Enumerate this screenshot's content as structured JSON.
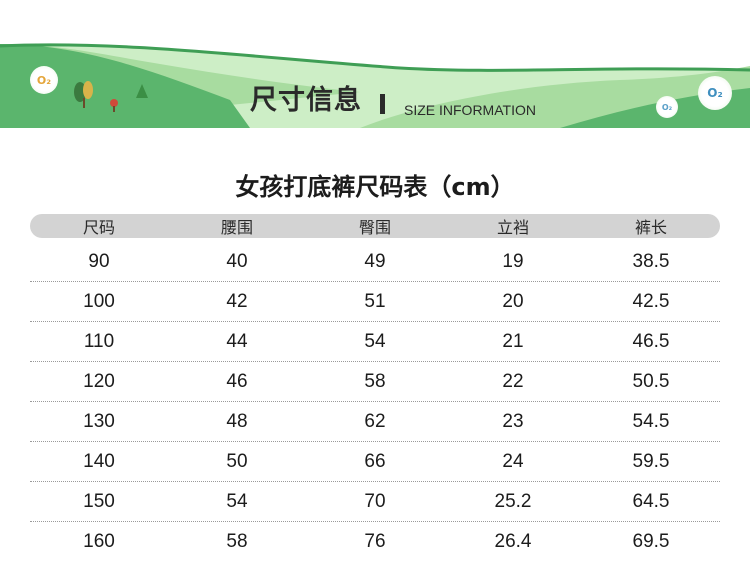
{
  "banner": {
    "title": "尺寸信息",
    "subtitle": "SIZE INFORMATION",
    "badge_left": "O₂",
    "badge_right_small": "O₂",
    "badge_right_big": "O₂",
    "colors": {
      "dark_green": "#5bb56d",
      "light_green": "#a8dca0",
      "pale_green": "#cdeec6",
      "stroke_green": "#3f9e55"
    }
  },
  "table": {
    "title": "女孩打底裤尺码表（cm）",
    "headers": [
      "尺码",
      "腰围",
      "臀围",
      "立裆",
      "裤长"
    ],
    "rows": [
      [
        "90",
        "40",
        "49",
        "19",
        "38.5"
      ],
      [
        "100",
        "42",
        "51",
        "20",
        "42.5"
      ],
      [
        "110",
        "44",
        "54",
        "21",
        "46.5"
      ],
      [
        "120",
        "46",
        "58",
        "22",
        "50.5"
      ],
      [
        "130",
        "48",
        "62",
        "23",
        "54.5"
      ],
      [
        "140",
        "50",
        "66",
        "24",
        "59.5"
      ],
      [
        "150",
        "54",
        "70",
        "25.2",
        "64.5"
      ],
      [
        "160",
        "58",
        "76",
        "26.4",
        "69.5"
      ]
    ]
  }
}
